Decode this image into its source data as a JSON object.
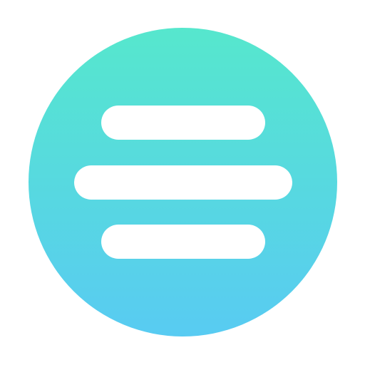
{
  "icon": {
    "name": "menu-icon",
    "colors": {
      "gradient_top": "#56E7CD",
      "gradient_bottom": "#58CBF2",
      "lines": "#FFFFFF"
    }
  }
}
